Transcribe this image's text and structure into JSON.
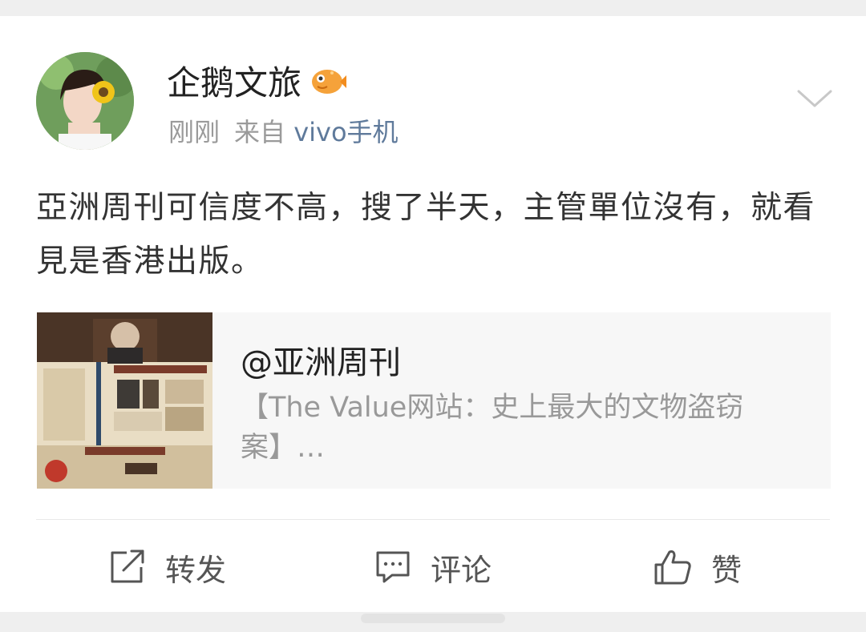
{
  "post": {
    "author": "企鹅文旅",
    "time": "刚刚",
    "source_prefix": "来自",
    "source": "vivo手机",
    "text": "亞洲周刊可信度不高，搜了半天，主管單位沒有，就看見是香港出版。"
  },
  "repost": {
    "author": "@亚洲周刊",
    "description": "【The Value网站：史上最大的文物盗窃案】…"
  },
  "actions": {
    "repost_label": "转发",
    "comment_label": "评论",
    "like_label": "赞"
  },
  "icons": {
    "badge": "fish-badge-icon",
    "menu": "chevron-down-icon",
    "repost": "share-icon",
    "comment": "comment-icon",
    "like": "thumbs-up-icon"
  },
  "colors": {
    "source_link": "#5f7a9b",
    "meta_gray": "#9a9a9a",
    "badge_orange": "#f5a23a"
  }
}
